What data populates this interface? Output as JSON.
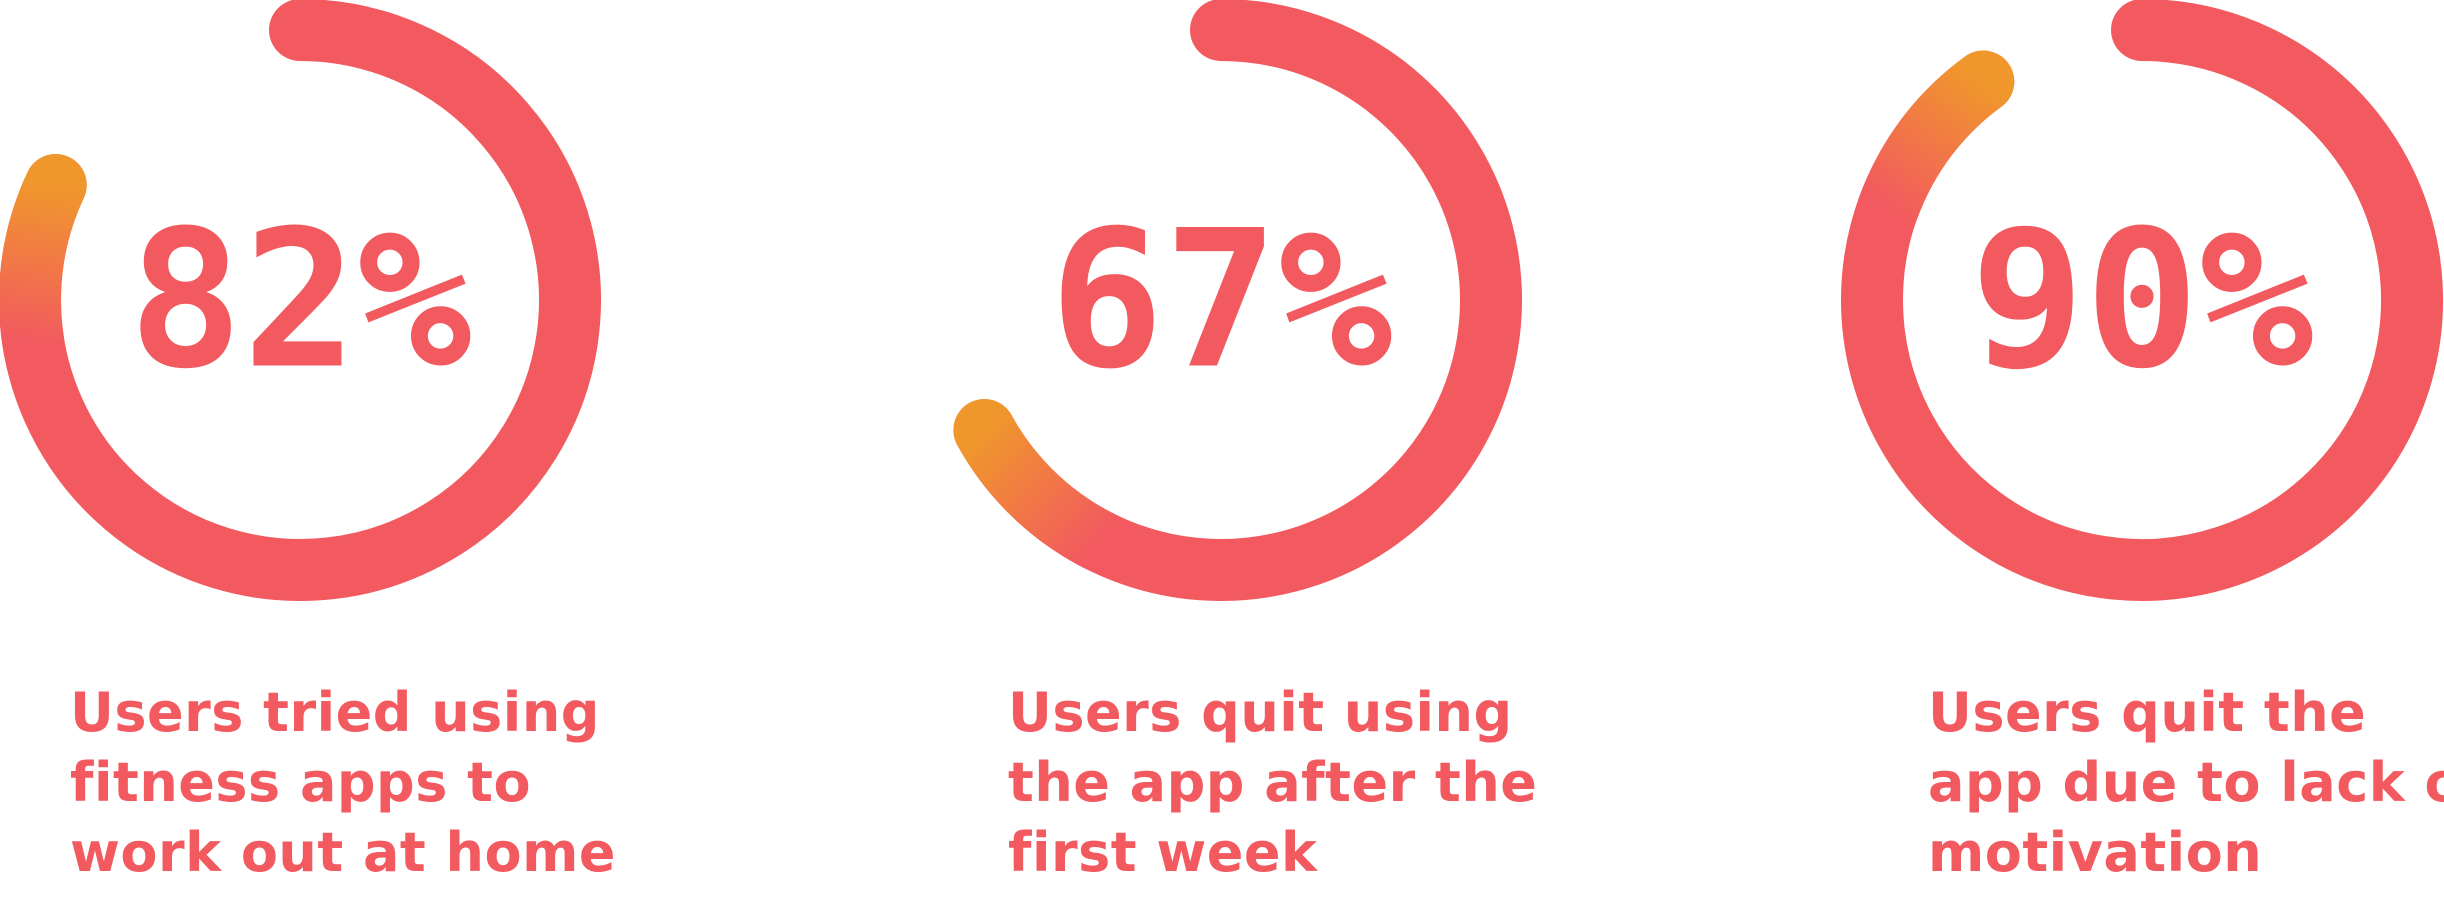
{
  "colors": {
    "ring": "#f25a5f",
    "ring_start": "#f0972c",
    "caption": "#f25a5f",
    "background": "#ffffff"
  },
  "chart_data": {
    "type": "radial-progress",
    "stats": [
      {
        "value": 82,
        "label": "82%",
        "caption_lines": [
          "Users tried using",
          "fitness apps to",
          "work out at home"
        ]
      },
      {
        "value": 67,
        "label": "67%",
        "caption_lines": [
          "Users quit using",
          "the app after the",
          "first week"
        ]
      },
      {
        "value": 90,
        "label": "90%",
        "caption_lines": [
          "Users quit the",
          "app due to lack of",
          "motivation"
        ]
      }
    ]
  }
}
